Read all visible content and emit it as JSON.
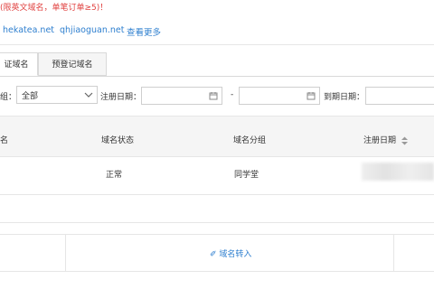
{
  "notice": {
    "text": "(限英文域名，单笔订单≥5)！"
  },
  "domain_links": [
    {
      "label": "hekatea.net"
    },
    {
      "label": "qhjiaoguan.net"
    },
    {
      "label": "查看更多"
    }
  ],
  "tabs": [
    {
      "label": "证域名",
      "active": true
    },
    {
      "label": "预登记域名",
      "active": false
    }
  ],
  "filters": {
    "group_label": "组：",
    "group_value": "全部",
    "reg_date_label": "注册日期：",
    "range_sep": "-",
    "expire_label": "到期日期："
  },
  "table": {
    "headers": [
      "名",
      "域名状态",
      "域名分组",
      "注册日期"
    ],
    "sort_icon": "sort-icon",
    "rows": [
      {
        "status": "正常",
        "group": "同学堂"
      }
    ]
  },
  "footer": {
    "transfer_label": "✐ 域名转入"
  },
  "colors": {
    "link": "#2e7fcf",
    "notice": "#e0403f",
    "header_bg": "#f5f5f5",
    "border": "#e6e6e6"
  }
}
